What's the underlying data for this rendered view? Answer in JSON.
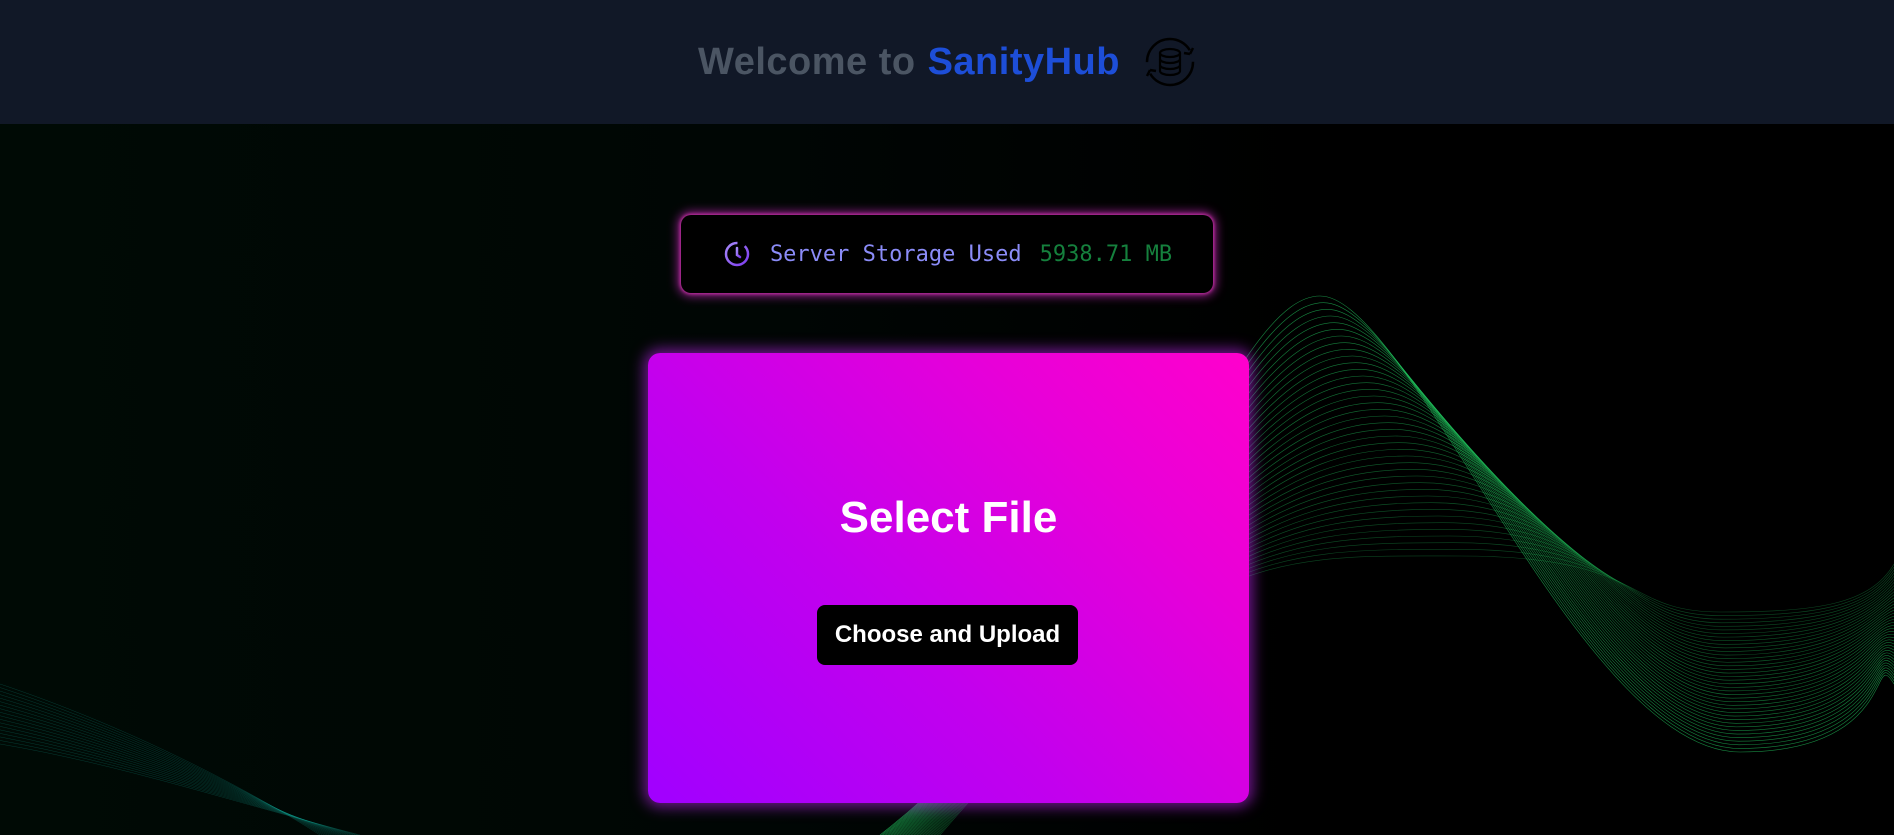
{
  "header": {
    "welcome_text": "Welcome to",
    "brand_name": "SanityHub",
    "icon": "database-sync-icon",
    "background_color": "#111827",
    "welcome_color": "#4b5563",
    "brand_color": "#1d4ed8"
  },
  "storage": {
    "icon": "clock-icon",
    "label": "Server Storage Used",
    "value": "5938.71 MB",
    "label_color": "#8b8cf8",
    "value_color": "#15803d"
  },
  "upload": {
    "title": "Select File",
    "button_label": "Choose and Upload",
    "gradient_start": "#a000ff",
    "gradient_end": "#ff00cc"
  },
  "background": {
    "decoration": "green-line-waves",
    "wave_color": "#22c55e"
  }
}
